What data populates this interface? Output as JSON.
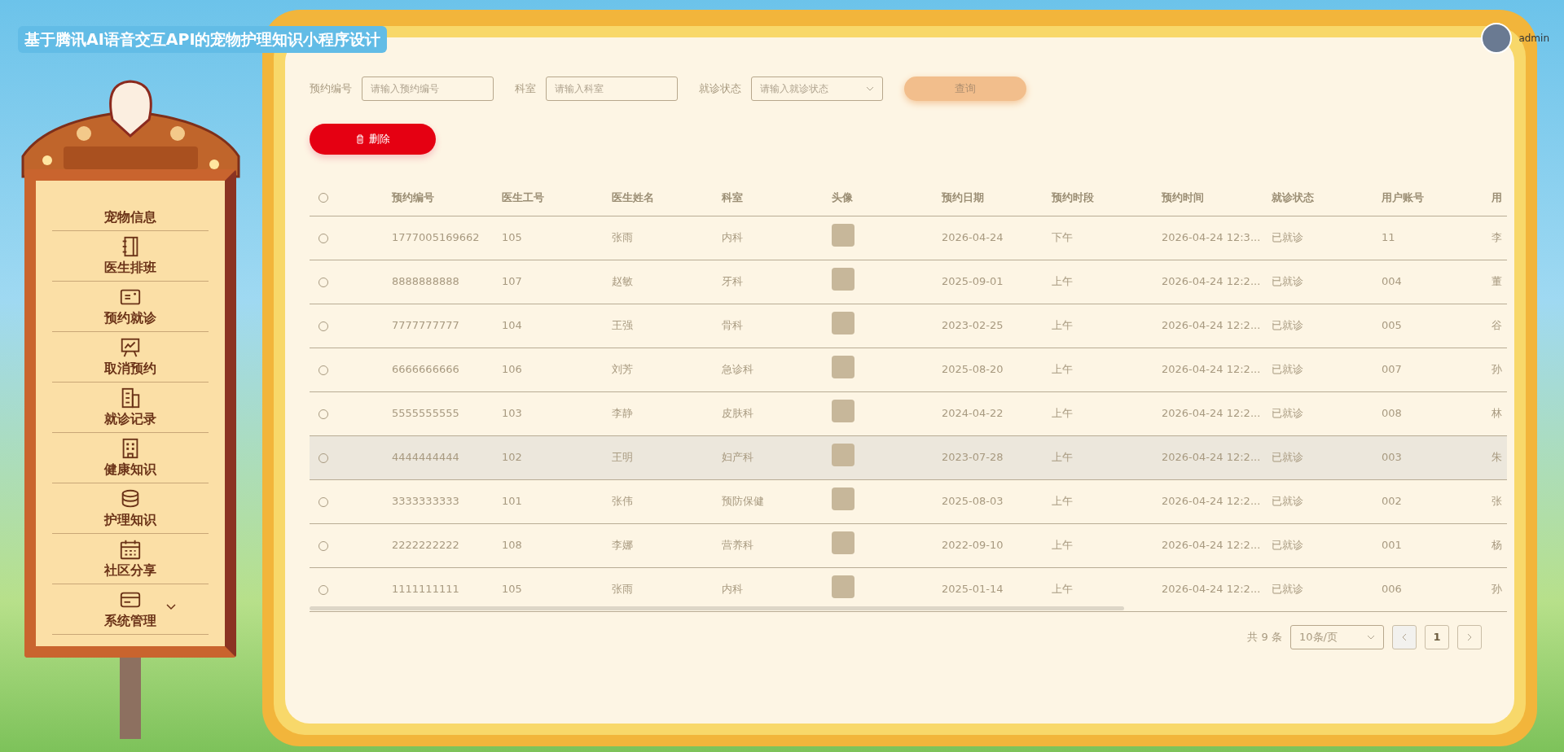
{
  "header": {
    "title": "基于腾讯AI语音交互API的宠物护理知识小程序设计",
    "user": "admin"
  },
  "sidebar": {
    "items": [
      {
        "label": "宠物信息",
        "expandable": false
      },
      {
        "label": "医生排班",
        "expandable": false
      },
      {
        "label": "预约就诊",
        "expandable": false
      },
      {
        "label": "取消预约",
        "expandable": false
      },
      {
        "label": "就诊记录",
        "expandable": false
      },
      {
        "label": "健康知识",
        "expandable": false
      },
      {
        "label": "护理知识",
        "expandable": false
      },
      {
        "label": "社区分享",
        "expandable": false
      },
      {
        "label": "系统管理",
        "expandable": true
      }
    ]
  },
  "filters": [
    {
      "kind": "input",
      "label": "预约编号",
      "placeholder": "请输入预约编号"
    },
    {
      "kind": "input",
      "label": "科室",
      "placeholder": "请输入科室"
    },
    {
      "kind": "select",
      "label": "就诊状态",
      "placeholder": "请输入就诊状态"
    }
  ],
  "search_button": "查询",
  "delete_button": "删除",
  "table": {
    "all_selected": false,
    "columns": [
      "预约编号",
      "医生工号",
      "医生姓名",
      "科室",
      "头像",
      "预约日期",
      "预约时段",
      "预约时间",
      "就诊状态",
      "用户账号",
      "用"
    ],
    "rows": [
      {
        "selected": false,
        "highlighted": false,
        "cells": [
          "1777005169662",
          "105",
          "张雨",
          "内科",
          "",
          "2026-04-24",
          "下午",
          "2026-04-24 12:3...",
          "已就诊",
          "11",
          "李"
        ]
      },
      {
        "selected": false,
        "highlighted": false,
        "cells": [
          "8888888888",
          "107",
          "赵敏",
          "牙科",
          "",
          "2025-09-01",
          "上午",
          "2026-04-24 12:2...",
          "已就诊",
          "004",
          "董"
        ]
      },
      {
        "selected": false,
        "highlighted": false,
        "cells": [
          "7777777777",
          "104",
          "王强",
          "骨科",
          "",
          "2023-02-25",
          "上午",
          "2026-04-24 12:2...",
          "已就诊",
          "005",
          "谷"
        ]
      },
      {
        "selected": false,
        "highlighted": false,
        "cells": [
          "6666666666",
          "106",
          "刘芳",
          "急诊科",
          "",
          "2025-08-20",
          "上午",
          "2026-04-24 12:2...",
          "已就诊",
          "007",
          "孙"
        ]
      },
      {
        "selected": false,
        "highlighted": false,
        "cells": [
          "5555555555",
          "103",
          "李静",
          "皮肤科",
          "",
          "2024-04-22",
          "上午",
          "2026-04-24 12:2...",
          "已就诊",
          "008",
          "林"
        ]
      },
      {
        "selected": false,
        "highlighted": true,
        "cells": [
          "4444444444",
          "102",
          "王明",
          "妇产科",
          "",
          "2023-07-28",
          "上午",
          "2026-04-24 12:2...",
          "已就诊",
          "003",
          "朱"
        ]
      },
      {
        "selected": false,
        "highlighted": false,
        "cells": [
          "3333333333",
          "101",
          "张伟",
          "预防保健",
          "",
          "2025-08-03",
          "上午",
          "2026-04-24 12:2...",
          "已就诊",
          "002",
          "张"
        ]
      },
      {
        "selected": false,
        "highlighted": false,
        "cells": [
          "2222222222",
          "108",
          "李娜",
          "营养科",
          "",
          "2022-09-10",
          "上午",
          "2026-04-24 12:2...",
          "已就诊",
          "001",
          "杨"
        ]
      },
      {
        "selected": false,
        "highlighted": false,
        "cells": [
          "1111111111",
          "105",
          "张雨",
          "内科",
          "",
          "2025-01-14",
          "上午",
          "2026-04-24 12:2...",
          "已就诊",
          "006",
          "孙"
        ]
      }
    ]
  },
  "pagination": {
    "total": "共 9 条",
    "page_size": "10条/页",
    "pages": [
      {
        "label": "1",
        "selected": true
      }
    ]
  }
}
